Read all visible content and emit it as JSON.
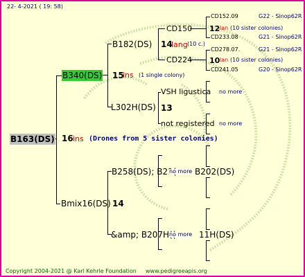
{
  "header": {
    "date": "22-  4-2021  ( 19: 58)"
  },
  "footer": {
    "copyright": "Copyright 2004-2021 @ Karl Kehrle Foundation",
    "site": "www.pedigreeapis.org"
  },
  "colors": {
    "border": "#e000a0",
    "background": "#ffffd8",
    "link_blue": "#000080",
    "ins_red": "#cc0000",
    "green_box": "#33cc33",
    "grey_box": "#c0c0c0"
  },
  "root": {
    "name": "B163(DS)",
    "num": "16",
    "ins": "ins",
    "note": "(Drones from 5 sister colonies)"
  },
  "gen1": {
    "top": {
      "name": "B340(DS)",
      "num": "15",
      "ins": "ins",
      "note": "(1 single colony)"
    },
    "bottom": {
      "name": "Bmix16(DS)",
      "num": "14"
    }
  },
  "gen2": {
    "b182": {
      "name": "B182(DS)",
      "num": "14",
      "lang": "lang",
      "note": "(10 c.)"
    },
    "l302": {
      "name": "L302H(DS)",
      "num": "13"
    },
    "b258": {
      "name": "B258(DS); B21(",
      "overlay": "no more",
      "suffix": "B202(DS)"
    },
    "b207": {
      "name": "&amp; B207H((",
      "overlay": "no more",
      "suffix": "11H(DS)"
    }
  },
  "gen3": {
    "cd150": {
      "name": "CD150",
      "num": "12",
      "lan": "lan",
      "note": "(10 sister colonies)"
    },
    "cd224": {
      "name": "CD224",
      "num": "10",
      "lan": "lan",
      "note": "(10 sister colonies)"
    },
    "vsh": {
      "name": "VSH ligustica",
      "more": "no more"
    },
    "notreg": {
      "name": "not registered",
      "more": "no more"
    }
  },
  "gen4": {
    "a": {
      "name": "CD152.09",
      "code": "G22 - Sinop62R"
    },
    "b": {
      "name": "CD233.08",
      "code": "G21 - Sinop62R"
    },
    "c": {
      "name": "CD278.07.",
      "code": "G21 - Sinop62R"
    },
    "d": {
      "name": "CD241.05",
      "code": "G20 - Sinop62R"
    }
  }
}
